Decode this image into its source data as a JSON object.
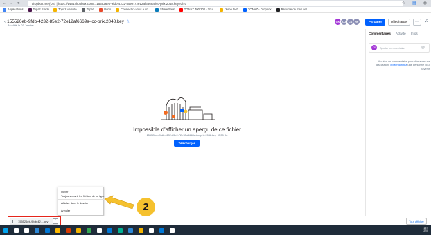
{
  "browser": {
    "url": "dropbox.me (US) | https://www.dropbox.com/...155526eb-9fdb-4232-85e2-72e12af6669a-icc-prix.2048.key?dl=0",
    "bookmarks": [
      {
        "label": "Applications",
        "color": "#4285f4"
      },
      {
        "label": "Topaz Slack",
        "color": "#4a154b"
      },
      {
        "label": "Topaz website",
        "color": "#f4b400"
      },
      {
        "label": "Topaz",
        "color": "#5f6368"
      },
      {
        "label": "Odoo",
        "color": "#e84a2b"
      },
      {
        "label": "Connectez-vous à vo...",
        "color": "#f4b400"
      },
      {
        "label": "SharePoint",
        "color": "#0a7cba"
      },
      {
        "label": "TONAZ 400/200 - You...",
        "color": "#ff0000"
      },
      {
        "label": "demo tech",
        "color": "#f4b400"
      },
      {
        "label": "TONAZ - Dropbox",
        "color": "#0061fe"
      },
      {
        "label": "Résumé de mes ser...",
        "color": "#202124"
      }
    ]
  },
  "header": {
    "file_name": "155526eb-9fdb-4232-85e2-72e12af6669a-icc-prix.2048.key",
    "modified": "Modifié le 03 Janvier",
    "avatars": [
      {
        "initials": "CK",
        "color": "#a336d6"
      },
      {
        "initials": "OJ",
        "color": "#8b8fb5"
      },
      {
        "initials": "CS",
        "color": "#8b8fb5"
      },
      {
        "initials": "HP",
        "color": "#8b8fb5"
      }
    ],
    "share_label": "Partager",
    "download_label": "Télécharger",
    "more_label": "···"
  },
  "viewer": {
    "message_title": "Impossible d'afficher un aperçu de ce fichier",
    "message_sub": "155526eb-9fdb-4232-85e2-72e12af6669a-icc-prix.2048.key · 2,38 Ko",
    "download_button": "Télécharger"
  },
  "panel": {
    "tabs": [
      "Commentaires",
      "Activité",
      "Infos",
      "I"
    ],
    "comment_placeholder": "Ajouter commentaire",
    "comment_avatar": "CK",
    "hint_pre": "Ajoutez un commentaire pour démarrer une discussion.",
    "hint_mention": "@Mentionnez",
    "hint_post": "une personne pour l'avertir."
  },
  "context_menu": {
    "items": [
      "Ouvrir",
      "Toujours ouvrir les fichiers de ce type",
      "Afficher dans le dossier",
      "Annuler"
    ]
  },
  "annotation": {
    "badge": "2"
  },
  "download_bar": {
    "item_label": "155526eb-9fdb-42....key",
    "show_all": "Tout afficher"
  },
  "taskbar": {
    "icons": [
      "#00a4ef",
      "#ffffff",
      "#ffffff",
      "#2b88d8",
      "#0078d7",
      "#ffb900",
      "#d83b01",
      "#f4b400",
      "#34a853",
      "#ffffff",
      "#0078d7",
      "#00b294",
      "#2b88d8",
      "#f4b400",
      "#ffffff",
      "#0078d7",
      "#ffffff"
    ],
    "clock_time": "15:4",
    "clock_date": "27/0"
  }
}
